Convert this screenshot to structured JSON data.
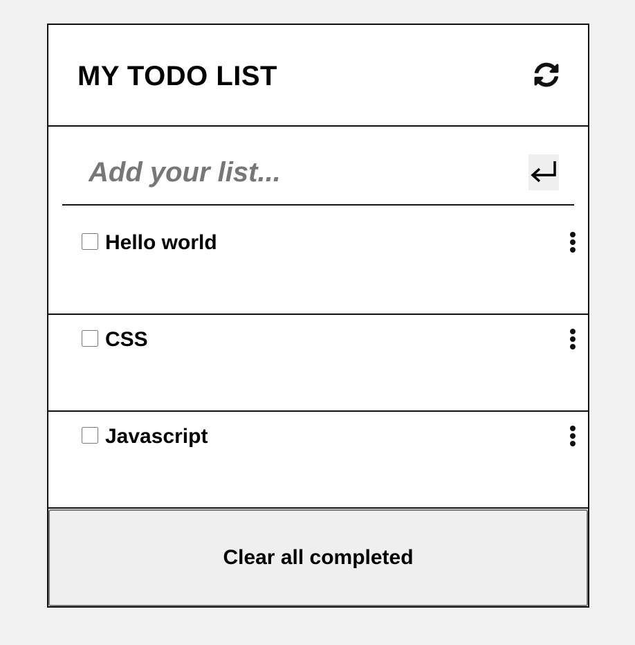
{
  "header": {
    "title": "MY TODO LIST",
    "refresh_icon": "refresh-icon"
  },
  "add": {
    "placeholder": "Add your list...",
    "value": "",
    "enter_icon": "enter-icon"
  },
  "todos": [
    {
      "label": "Hello world",
      "checked": false
    },
    {
      "label": "CSS",
      "checked": false
    },
    {
      "label": "Javascript",
      "checked": false
    }
  ],
  "footer": {
    "clear_label": "Clear all completed"
  },
  "colors": {
    "page_background": "#f1f1f1",
    "panel_background": "#ffffff",
    "border": "#111111",
    "placeholder": "#777777",
    "button_background": "#efefef"
  }
}
